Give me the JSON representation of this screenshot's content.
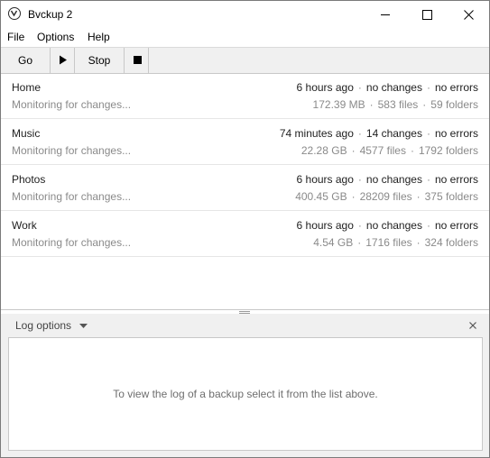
{
  "window": {
    "title": "Bvckup 2",
    "icon": "bvckup-logo-icon"
  },
  "menu": {
    "file": "File",
    "options": "Options",
    "help": "Help"
  },
  "toolbar": {
    "go_label": "Go",
    "stop_label": "Stop",
    "play_icon": "play-icon",
    "halt_icon": "stop-square-icon"
  },
  "backups": [
    {
      "name": "Home",
      "status": "Monitoring for changes...",
      "last_run": "6 hours ago",
      "changes": "no changes",
      "errors": "no errors",
      "size": "172.39 MB",
      "files": "583 files",
      "folders": "59 folders"
    },
    {
      "name": "Music",
      "status": "Monitoring for changes...",
      "last_run": "74 minutes ago",
      "changes": "14 changes",
      "errors": "no errors",
      "size": "22.28 GB",
      "files": "4577 files",
      "folders": "1792 folders"
    },
    {
      "name": "Photos",
      "status": "Monitoring for changes...",
      "last_run": "6 hours ago",
      "changes": "no changes",
      "errors": "no errors",
      "size": "400.45 GB",
      "files": "28209 files",
      "folders": "375 folders"
    },
    {
      "name": "Work",
      "status": "Monitoring for changes...",
      "last_run": "6 hours ago",
      "changes": "no changes",
      "errors": "no errors",
      "size": "4.54 GB",
      "files": "1716 files",
      "folders": "324 folders"
    }
  ],
  "separator": "·",
  "log": {
    "options_label": "Log options",
    "empty_message": "To view the log of a backup select it from the list above."
  },
  "colors": {
    "primary_text": "#1e1e1e",
    "secondary_text": "#8a8a8a",
    "pane_background": "#f0f0f0"
  }
}
